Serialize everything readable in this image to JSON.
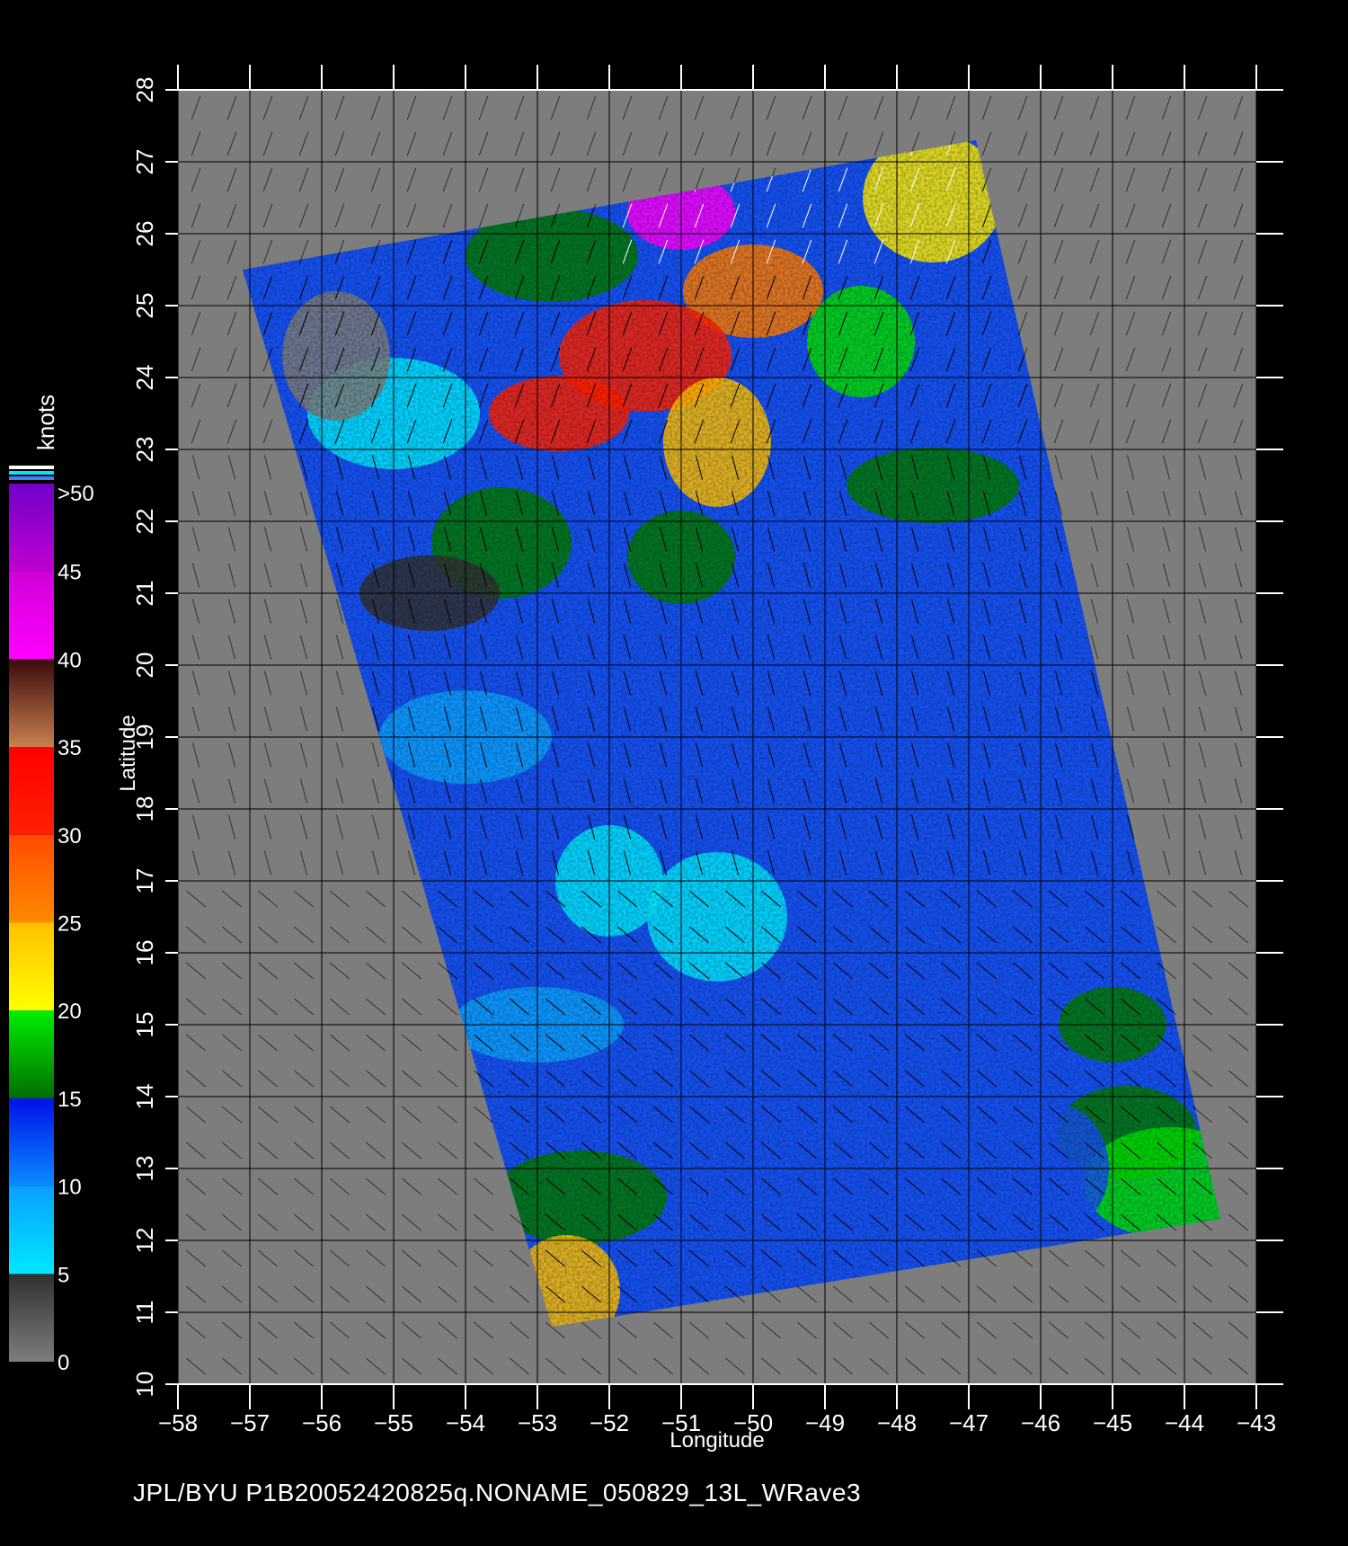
{
  "footer": "JPL/BYU  P1B20052420825q.NONAME_050829_13L_WRave3",
  "axes": {
    "x_label": "Longitude",
    "y_label": "Latitude",
    "x_range": [
      -58,
      -43
    ],
    "y_range": [
      10,
      28
    ],
    "x_ticks": [
      "−58",
      "−57",
      "−56",
      "−55",
      "−54",
      "−53",
      "−52",
      "−51",
      "−50",
      "−49",
      "−48",
      "−47",
      "−46",
      "−45",
      "−44",
      "−43"
    ],
    "y_ticks": [
      "10",
      "11",
      "12",
      "13",
      "14",
      "15",
      "16",
      "17",
      "18",
      "19",
      "20",
      "21",
      "22",
      "23",
      "24",
      "25",
      "26",
      "27",
      "28"
    ]
  },
  "legend": {
    "title": "knots",
    "labels": [
      ">50",
      "45",
      "40",
      "35",
      "30",
      "25",
      "20",
      "15",
      "10",
      "5",
      "0"
    ],
    "bands": [
      {
        "from": 0,
        "to": 5,
        "colors": [
          "#7d7d7d",
          "#303030"
        ]
      },
      {
        "from": 5,
        "to": 10,
        "colors": [
          "#00e8ff",
          "#0aa0ff"
        ]
      },
      {
        "from": 10,
        "to": 15,
        "colors": [
          "#0a8cff",
          "#0010e8"
        ]
      },
      {
        "from": 15,
        "to": 20,
        "colors": [
          "#006e00",
          "#00ee00"
        ]
      },
      {
        "from": 20,
        "to": 25,
        "colors": [
          "#ffff00",
          "#ffc000"
        ]
      },
      {
        "from": 25,
        "to": 30,
        "colors": [
          "#ff8a00",
          "#ff4a00"
        ]
      },
      {
        "from": 30,
        "to": 35,
        "colors": [
          "#ff2000",
          "#ff0000"
        ]
      },
      {
        "from": 35,
        "to": 40,
        "colors": [
          "#c88050",
          "#3a0a0a"
        ]
      },
      {
        "from": 40,
        "to": 45,
        "colors": [
          "#ff00ff",
          "#d000d8"
        ]
      },
      {
        "from": 45,
        "to": 50,
        "colors": [
          "#c000d0",
          "#7000c8"
        ]
      }
    ]
  },
  "colors": {
    "background": "#000000",
    "land_mask": "#7d7d7d",
    "grid": "#000000",
    "wind_barb": "#000000",
    "wind_barb_high": "#ffffff"
  },
  "swath": {
    "corners_lonlat": [
      [
        -57.1,
        25.5
      ],
      [
        -46.9,
        27.3
      ],
      [
        -43.5,
        12.3
      ],
      [
        -52.8,
        10.8
      ]
    ],
    "wind_field": [
      {
        "lon": -51.0,
        "lat": 26.3,
        "speed": 42
      },
      {
        "lon": -50.0,
        "lat": 25.2,
        "speed": 30
      },
      {
        "lon": -51.5,
        "lat": 24.3,
        "speed": 32
      },
      {
        "lon": -50.5,
        "lat": 23.1,
        "speed": 24
      },
      {
        "lon": -52.7,
        "lat": 23.5,
        "speed": 31
      },
      {
        "lon": -52.8,
        "lat": 25.7,
        "speed": 18
      },
      {
        "lon": -48.5,
        "lat": 24.5,
        "speed": 20
      },
      {
        "lon": -47.5,
        "lat": 26.5,
        "speed": 21
      },
      {
        "lon": -47.5,
        "lat": 22.5,
        "speed": 16
      },
      {
        "lon": -51.0,
        "lat": 21.5,
        "speed": 17
      },
      {
        "lon": -53.5,
        "lat": 21.7,
        "speed": 16
      },
      {
        "lon": -50.0,
        "lat": 20.0,
        "speed": 13
      },
      {
        "lon": -49.0,
        "lat": 19.5,
        "speed": 12
      },
      {
        "lon": -48.0,
        "lat": 18.0,
        "speed": 12
      },
      {
        "lon": -55.0,
        "lat": 23.5,
        "speed": 7
      },
      {
        "lon": -55.8,
        "lat": 24.3,
        "speed": 3
      },
      {
        "lon": -54.5,
        "lat": 21.0,
        "speed": 4
      },
      {
        "lon": -54.0,
        "lat": 19.0,
        "speed": 9
      },
      {
        "lon": -52.0,
        "lat": 17.0,
        "speed": 7
      },
      {
        "lon": -50.5,
        "lat": 16.5,
        "speed": 8
      },
      {
        "lon": -53.0,
        "lat": 15.0,
        "speed": 10
      },
      {
        "lon": -50.0,
        "lat": 14.0,
        "speed": 12
      },
      {
        "lon": -47.5,
        "lat": 15.0,
        "speed": 13
      },
      {
        "lon": -46.0,
        "lat": 17.0,
        "speed": 13
      },
      {
        "lon": -45.0,
        "lat": 15.0,
        "speed": 16
      },
      {
        "lon": -44.8,
        "lat": 13.5,
        "speed": 17
      },
      {
        "lon": -44.2,
        "lat": 12.8,
        "speed": 19
      },
      {
        "lon": -45.8,
        "lat": 13.0,
        "speed": 14
      },
      {
        "lon": -51.0,
        "lat": 12.0,
        "speed": 14
      },
      {
        "lon": -52.4,
        "lat": 12.6,
        "speed": 17
      },
      {
        "lon": -52.6,
        "lat": 11.3,
        "speed": 25
      },
      {
        "lon": -48.0,
        "lat": 12.5,
        "speed": 12
      }
    ]
  }
}
